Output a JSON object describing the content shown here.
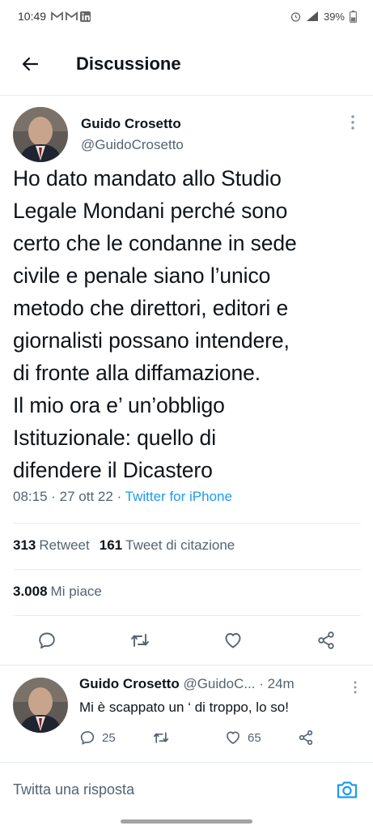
{
  "status_bar": {
    "time": "10:49",
    "notification_icons": [
      "gmail-icon",
      "gmail-icon",
      "linkedin-icon"
    ],
    "battery": "39%"
  },
  "header": {
    "title": "Discussione"
  },
  "tweet": {
    "author_name": "Guido Crosetto",
    "author_handle": "@GuidoCrosetto",
    "text": "Ho dato mandato allo Studio\nLegale Mondani perché sono\ncerto che le condanne in sede\ncivile e penale siano l’unico\nmetodo che direttori, editori e\ngiornalisti possano intendere,\ndi fronte alla diffamazione.\nIl mio ora e’ un’obbligo\nIstituzionale: quello di\ndifendere il Dicastero",
    "time": "08:15",
    "date": "27 ott 22",
    "source": "Twitter for iPhone",
    "retweets_count": "313",
    "retweets_label": "Retweet",
    "quotes_count": "161",
    "quotes_label": "Tweet di citazione",
    "likes_count": "3.008",
    "likes_label": "Mi piace"
  },
  "reply": {
    "author_name": "Guido Crosetto",
    "author_handle": "@GuidoC...",
    "age": "· 24m",
    "text": "Mi è scappato un ‘ di troppo, lo so!",
    "reply_count": "25",
    "retweet_count": "",
    "like_count": "65"
  },
  "compose": {
    "placeholder": "Twitta una risposta"
  },
  "colors": {
    "accent": "#1d9bf0",
    "text": "#0f1419",
    "secondary": "#536471",
    "divider": "#e6ecf0"
  }
}
